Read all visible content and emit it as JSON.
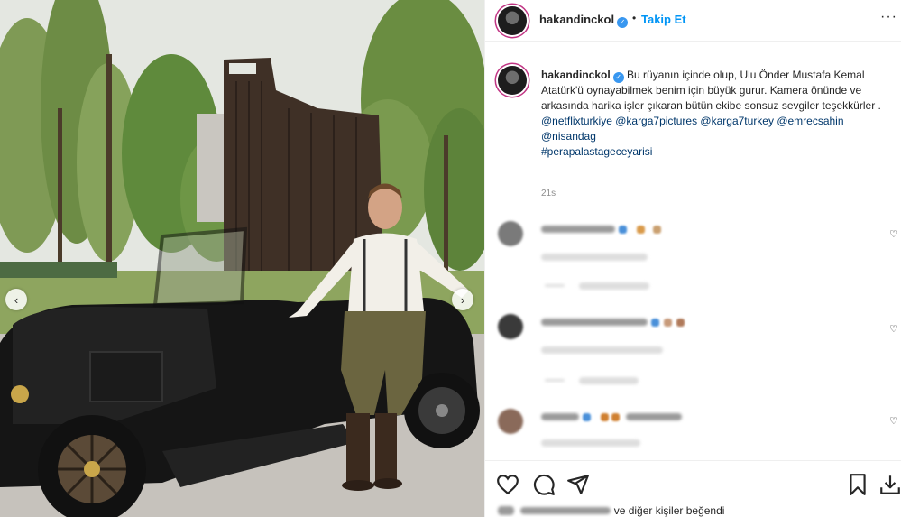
{
  "post": {
    "username": "hakandinckol",
    "follow_label": "Takip Et",
    "separator": "•",
    "more_label": "···",
    "caption_text": "Bu rüyanın içinde olup, Ulu Önder Mustafa Kemal Atatürk'ü oynayabilmek benim için büyük gurur. Kamera önünde ve arkasında harika işler çıkaran bütün ekibe sonsuz sevgiler teşekkürler .",
    "mentions_line1": "@netflixturkiye @karga7pictures @karga7turkey @emrecsahin",
    "mentions_line2": "@nisandag",
    "hashtag": "#perapalastageceyarisi",
    "time_ago": "21s"
  },
  "likes": {
    "suffix": "ve diğer kişiler beğendi"
  },
  "icons": {
    "verified": "✓",
    "prev": "‹",
    "next": "›",
    "comment_heart": "♡"
  },
  "colors": {
    "accent_blue": "#0095f6",
    "link": "#00376b",
    "verified_blue": "#3897f0",
    "text": "#262626",
    "muted": "#8e8e8e"
  }
}
